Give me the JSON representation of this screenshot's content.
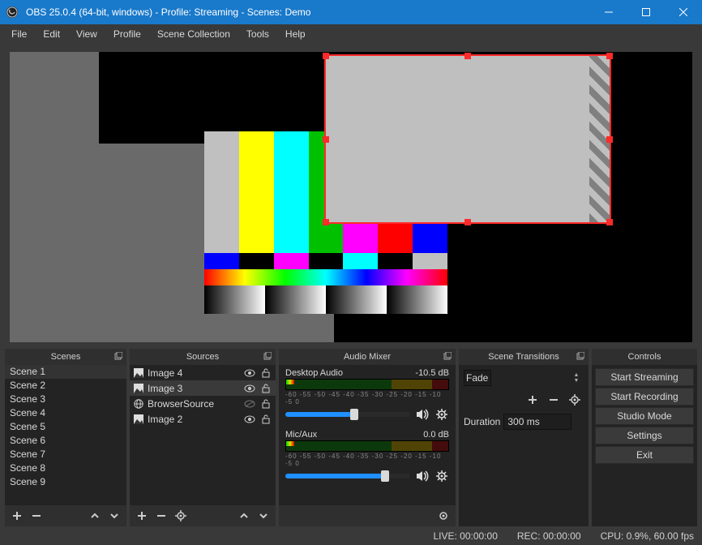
{
  "window": {
    "title": "OBS 25.0.4 (64-bit, windows) - Profile: Streaming - Scenes: Demo"
  },
  "menu": [
    "File",
    "Edit",
    "View",
    "Profile",
    "Scene Collection",
    "Tools",
    "Help"
  ],
  "panels": {
    "scenes": {
      "title": "Scenes"
    },
    "sources": {
      "title": "Sources"
    },
    "mixer": {
      "title": "Audio Mixer"
    },
    "transitions": {
      "title": "Scene Transitions"
    },
    "controls": {
      "title": "Controls"
    }
  },
  "scenes": [
    "Scene 1",
    "Scene 2",
    "Scene 3",
    "Scene 4",
    "Scene 5",
    "Scene 6",
    "Scene 7",
    "Scene 8",
    "Scene 9"
  ],
  "sources": [
    {
      "icon": "image-icon",
      "label": "Image 4",
      "visible": true,
      "locked": false,
      "selected": false
    },
    {
      "icon": "image-icon",
      "label": "Image 3",
      "visible": true,
      "locked": false,
      "selected": true
    },
    {
      "icon": "browser-icon",
      "label": "BrowserSource",
      "visible": false,
      "locked": false,
      "selected": false
    },
    {
      "icon": "image-icon",
      "label": "Image 2",
      "visible": true,
      "locked": false,
      "selected": false
    }
  ],
  "mixer": [
    {
      "name": "Desktop Audio",
      "db": "-10.5 dB",
      "scale": "-60  -55  -50  -45  -40  -35  -30  -25  -20  -15  -10  -5  0",
      "slider": 0.55
    },
    {
      "name": "Mic/Aux",
      "db": "0.0 dB",
      "scale": "-60  -55  -50  -45  -40  -35  -30  -25  -20  -15  -10  -5  0",
      "slider": 0.8
    }
  ],
  "transitions": {
    "selected": "Fade",
    "duration_label": "Duration",
    "duration_value": "300 ms"
  },
  "controls": {
    "start_streaming": "Start Streaming",
    "start_recording": "Start Recording",
    "studio_mode": "Studio Mode",
    "settings": "Settings",
    "exit": "Exit"
  },
  "status": {
    "live": "LIVE: 00:00:00",
    "rec": "REC: 00:00:00",
    "cpu": "CPU: 0.9%, 60.00 fps"
  },
  "colors": {
    "accent": "#1979ca",
    "selection": "#ff2a2a"
  }
}
